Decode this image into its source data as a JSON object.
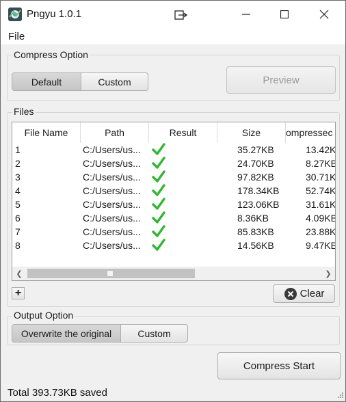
{
  "window": {
    "title": "Pngyu 1.0.1"
  },
  "menu": {
    "file": "File"
  },
  "compress_option": {
    "title": "Compress Option",
    "modes": [
      {
        "label": "Default",
        "selected": true
      },
      {
        "label": "Custom",
        "selected": false
      }
    ],
    "preview_label": "Preview"
  },
  "files": {
    "title": "Files",
    "columns": [
      "File Name",
      "Path",
      "Result",
      "Size",
      "ompressec"
    ],
    "rows": [
      {
        "name": "1",
        "path": "C:/Users/us...",
        "result": "success",
        "size": "35.27KB",
        "compressed": "13.42K"
      },
      {
        "name": "2",
        "path": "C:/Users/us...",
        "result": "success",
        "size": "24.70KB",
        "compressed": "8.27KB"
      },
      {
        "name": "3",
        "path": "C:/Users/us...",
        "result": "success",
        "size": "97.82KB",
        "compressed": "30.71K"
      },
      {
        "name": "4",
        "path": "C:/Users/us...",
        "result": "success",
        "size": "178.34KB",
        "compressed": "52.74K"
      },
      {
        "name": "5",
        "path": "C:/Users/us...",
        "result": "success",
        "size": "123.06KB",
        "compressed": "31.61K"
      },
      {
        "name": "6",
        "path": "C:/Users/us...",
        "result": "success",
        "size": "8.36KB",
        "compressed": "4.09KB"
      },
      {
        "name": "7",
        "path": "C:/Users/us...",
        "result": "success",
        "size": "85.83KB",
        "compressed": "23.88K"
      },
      {
        "name": "8",
        "path": "C:/Users/us...",
        "result": "success",
        "size": "14.56KB",
        "compressed": "9.47KB"
      }
    ],
    "add_label": "+",
    "clear_label": "Clear"
  },
  "output_option": {
    "title": "Output Option",
    "modes": [
      {
        "label": "Overwrite the original",
        "selected": true
      },
      {
        "label": "Custom",
        "selected": false
      }
    ]
  },
  "compress_start_label": "Compress Start",
  "status": "Total 393.73KB saved",
  "colors": {
    "check": "#2db82d",
    "clear_icon": "#3a3a3a"
  }
}
